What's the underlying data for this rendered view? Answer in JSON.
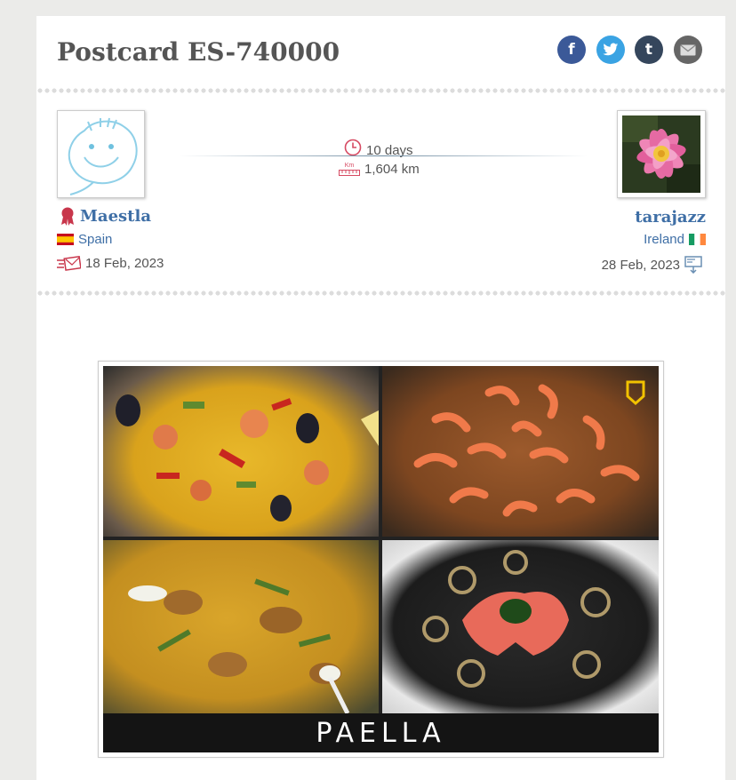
{
  "page": {
    "title": "Postcard ES-740000"
  },
  "share": [
    {
      "name": "facebook-icon",
      "glyph": "f",
      "color": "#3b5998"
    },
    {
      "name": "twitter-icon",
      "glyph": "🐦",
      "color": "#1da1f2"
    },
    {
      "name": "tumblr-icon",
      "glyph": "t",
      "color": "#35465c"
    },
    {
      "name": "email-icon",
      "glyph": "✉",
      "color": "#666666"
    }
  ],
  "sender": {
    "username": "Maestla",
    "country": "Spain",
    "date": "18 Feb, 2023"
  },
  "receiver": {
    "username": "tarajazz",
    "country": "Ireland",
    "date": "28 Feb, 2023"
  },
  "travel": {
    "duration": "10 days",
    "distance": "1,604 km",
    "km_label": "Km"
  },
  "postcard": {
    "caption": "PAELLA"
  },
  "colors": {
    "link": "#3f6fa6",
    "title": "#555555",
    "accent": "#c8364b"
  }
}
